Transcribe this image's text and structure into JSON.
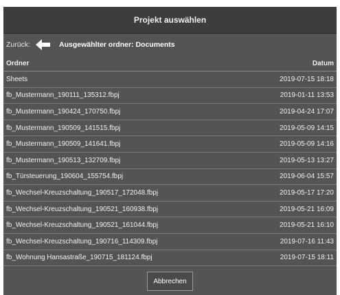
{
  "dialog": {
    "title": "Projekt auswählen",
    "back_label": "Zurück:",
    "selected_folder": "Ausgewählter ordner: Documents",
    "cancel_label": "Abbrechen"
  },
  "table": {
    "headers": {
      "name": "Ordner",
      "date": "Datum"
    },
    "rows": [
      {
        "name": "Sheets",
        "date": "2019-07-15 18:18"
      },
      {
        "name": "fb_Mustermann_190111_135312.fbpj",
        "date": "2019-01-11 13:53"
      },
      {
        "name": "fb_Mustermann_190424_170750.fbpj",
        "date": "2019-04-24 17:07"
      },
      {
        "name": "fb_Mustermann_190509_141515.fbpj",
        "date": "2019-05-09 14:15"
      },
      {
        "name": "fb_Mustermann_190509_141641.fbpj",
        "date": "2019-05-09 14:16"
      },
      {
        "name": "fb_Mustermann_190513_132709.fbpj",
        "date": "2019-05-13 13:27"
      },
      {
        "name": "fb_Türsteuerung_190604_155754.fbpj",
        "date": "2019-06-04 15:57"
      },
      {
        "name": "fb_Wechsel-Kreuzschaltung_190517_172048.fbpj",
        "date": "2019-05-17 17:20"
      },
      {
        "name": "fb_Wechsel-Kreuzschaltung_190521_160938.fbpj",
        "date": "2019-05-21 16:09"
      },
      {
        "name": "fb_Wechsel-Kreuzschaltung_190521_161044.fbpj",
        "date": "2019-05-21 16:10"
      },
      {
        "name": "fb_Wechsel-Kreuzschaltung_190716_114309.fbpj",
        "date": "2019-07-16 11:43"
      },
      {
        "name": "fb_Wohnung Hansastraße_190715_181124.fbpj",
        "date": "2019-07-15 18:11"
      }
    ]
  },
  "icons": {
    "back": "arrow-left-icon"
  }
}
